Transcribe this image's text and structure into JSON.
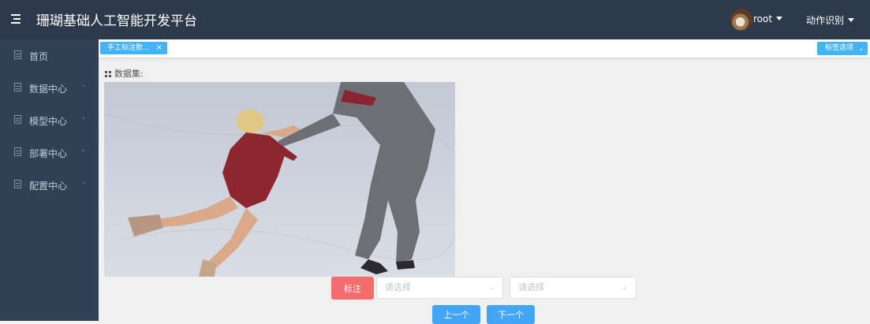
{
  "header": {
    "title": "珊瑚基础人工智能开发平台",
    "user": "root",
    "action_menu": "动作识别"
  },
  "sidebar": {
    "items": [
      {
        "label": "首页",
        "icon": "doc-icon",
        "expandable": false
      },
      {
        "label": "数据中心",
        "icon": "doc-icon",
        "expandable": true
      },
      {
        "label": "模型中心",
        "icon": "doc-icon",
        "expandable": true
      },
      {
        "label": "部署中心",
        "icon": "doc-icon",
        "expandable": true
      },
      {
        "label": "配置中心",
        "icon": "doc-icon",
        "expandable": true
      }
    ]
  },
  "tabs": {
    "active_tab": "手工标注数...",
    "close_symbol": "×",
    "options_label": "标签选项"
  },
  "main": {
    "dataset_label": "数据集:",
    "image_description_icon": "figure-skating-pair-photo",
    "mark_button": "标注",
    "select1_placeholder": "请选择",
    "select2_placeholder": "请选择",
    "prev_button": "上一个",
    "next_button": "下一个"
  },
  "colors": {
    "header_bg": "#2d3a4b",
    "sidebar_bg": "#304156",
    "accent_blue": "#42b4f5",
    "mark_red": "#f56c6c"
  }
}
